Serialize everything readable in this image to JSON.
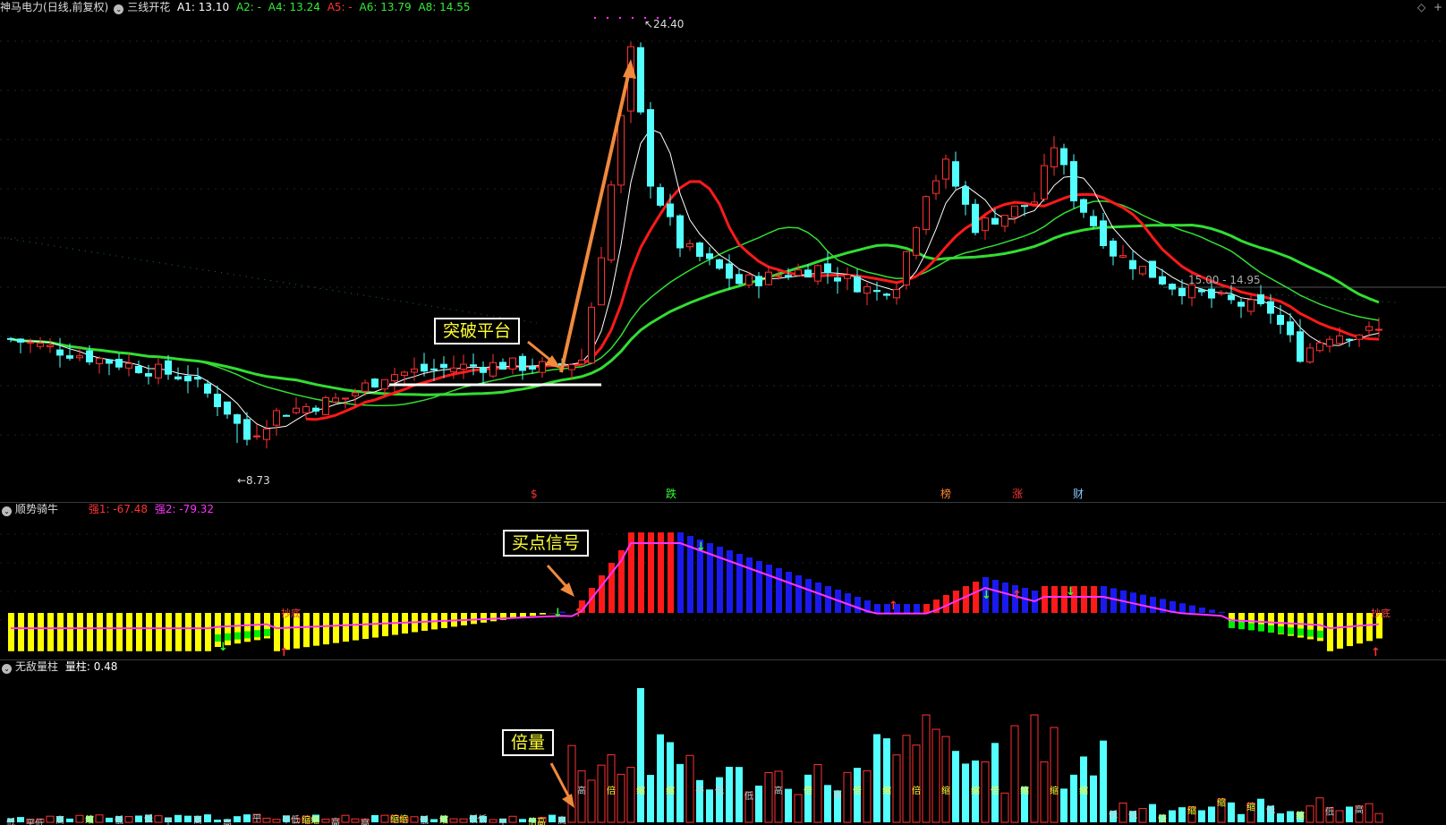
{
  "header": {
    "stock": "神马电力",
    "period": "(日线,前复权)",
    "indicator": "三线开花",
    "a1": "A1: 13.10",
    "a2": "A2: -",
    "a4": "A4: 13.24",
    "a5": "A5: -",
    "a6": "A6: 13.79",
    "a8": "A8: 14.55",
    "corner_icons": [
      "◇",
      "+"
    ]
  },
  "main_chart": {
    "high_label": "24.40",
    "low_label": "8.73",
    "range_label": "15.00 - 14.95",
    "event_markers": [
      "$",
      "跌",
      "榜",
      "涨",
      "财"
    ],
    "annotation": "突破平台"
  },
  "panel2": {
    "title": "顺势骑牛",
    "v1": "强1: -67.48",
    "v2": "强2: -79.32",
    "annotation": "买点信号",
    "signal_labels": [
      "抄底",
      "抄底"
    ]
  },
  "panel3": {
    "title": "无敌量柱",
    "v1": "量柱: 0.48",
    "annotation": "倍量",
    "bar_tags": [
      "低",
      "平低",
      "高",
      "缩",
      "低",
      "低",
      "平",
      "高",
      "高",
      "平",
      "平低",
      "缩缩",
      "高",
      "高",
      "缩缩",
      "低",
      "缩",
      "低低",
      "平",
      "倍高",
      "高",
      "高",
      "倍",
      "缩",
      "缩",
      "平",
      "低",
      "低",
      "高",
      "倍",
      "高",
      "倍",
      "缩",
      "倍",
      "缩",
      "缩",
      "倍",
      "缩",
      "缩",
      "缩",
      "低",
      "低",
      "倍",
      "缩",
      "缩",
      "缩",
      "低",
      "缩",
      "低",
      "高"
    ]
  },
  "colors": {
    "up": "#ff3232",
    "down": "#54ffff",
    "ma_green": "#33dd33",
    "ma_red": "#ff1a1a",
    "bar_yellow": "#ffff00",
    "bar_blue": "#1a1aee",
    "bar_red": "#ff1a1a",
    "bar_green": "#00ee00",
    "annotation_arrow": "#f08a3c"
  }
}
